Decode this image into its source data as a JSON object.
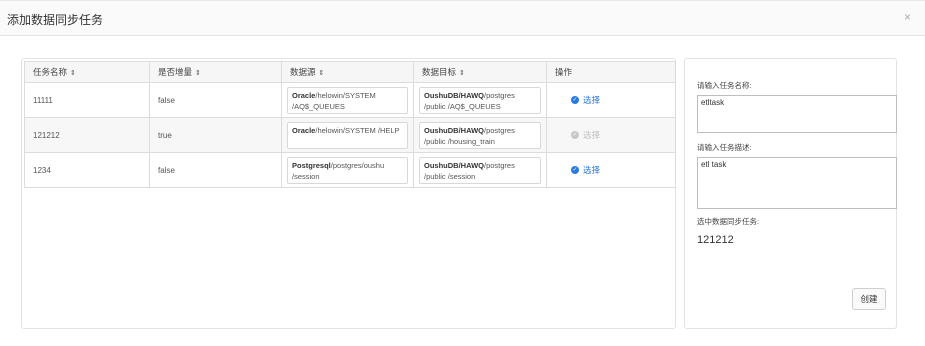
{
  "dialog": {
    "title": "添加数据同步任务",
    "close": "×"
  },
  "table": {
    "headers": [
      "任务名称",
      "是否增量",
      "数据源",
      "数据目标",
      "操作"
    ],
    "sort_icon": "⇕",
    "rows": [
      {
        "name": "11111",
        "incremental": "false",
        "source_bold": "Oracle",
        "source_rest": "/helowin/SYSTEM /AQ$_QUEUES",
        "target_bold": "OushuDB/HAWQ",
        "target_rest": "/postgres /public /AQ$_QUEUES",
        "action": "选择",
        "action_enabled": true
      },
      {
        "name": "121212",
        "incremental": "true",
        "source_bold": "Oracle",
        "source_rest": "/helowin/SYSTEM /HELP",
        "target_bold": "OushuDB/HAWQ",
        "target_rest": "/postgres /public /housing_train",
        "action": "选择",
        "action_enabled": false
      },
      {
        "name": "1234",
        "incremental": "false",
        "source_bold": "Postgresql",
        "source_rest": "/postgres/oushu /session",
        "target_bold": "OushuDB/HAWQ",
        "target_rest": "/postgres /public /session",
        "action": "选择",
        "action_enabled": true
      }
    ]
  },
  "form": {
    "name_label": "请输入任务名称:",
    "name_value": "etltask",
    "desc_label": "请输入任务描述:",
    "desc_value": "etl task",
    "selected_label": "选中数据同步任务:",
    "selected_value": "121212",
    "create_button": "创建"
  },
  "colors": {
    "accent": "#2a7ae4",
    "disabled": "#c0c0c0"
  }
}
